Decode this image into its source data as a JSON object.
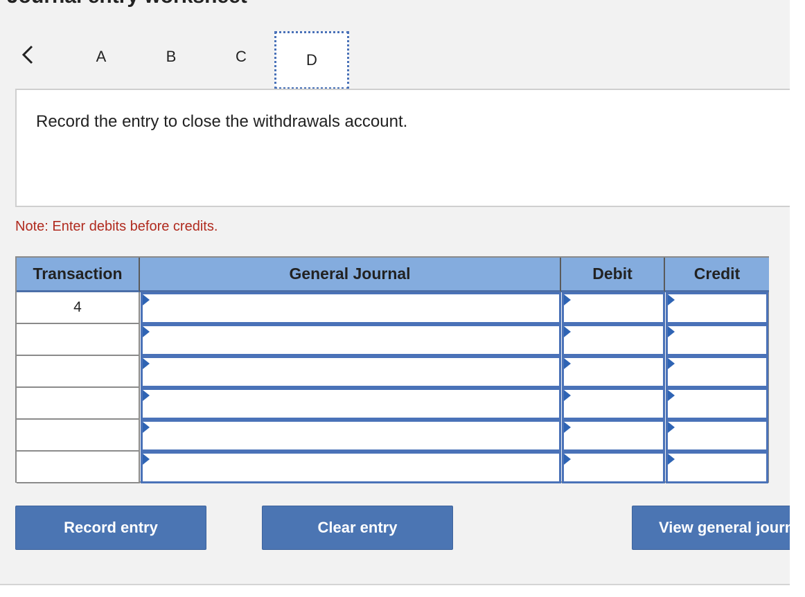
{
  "header": {
    "title": "Journal entry worksheet"
  },
  "tabs": [
    {
      "label": "A"
    },
    {
      "label": "B"
    },
    {
      "label": "C"
    },
    {
      "label": "D"
    }
  ],
  "icons": {
    "back": "chevron-left-icon",
    "input_marker": "triangle-marker-icon"
  },
  "instruction": "Record the entry to close the withdrawals account.",
  "note": "Note: Enter debits before credits.",
  "journal": {
    "columns": [
      "Transaction",
      "General Journal",
      "Debit",
      "Credit"
    ],
    "rows": [
      {
        "transaction": "4",
        "account": "",
        "debit": "",
        "credit": ""
      },
      {
        "transaction": "",
        "account": "",
        "debit": "",
        "credit": ""
      },
      {
        "transaction": "",
        "account": "",
        "debit": "",
        "credit": ""
      },
      {
        "transaction": "",
        "account": "",
        "debit": "",
        "credit": ""
      },
      {
        "transaction": "",
        "account": "",
        "debit": "",
        "credit": ""
      },
      {
        "transaction": "",
        "account": "",
        "debit": "",
        "credit": ""
      }
    ]
  },
  "buttons": {
    "record": "Record entry",
    "clear": "Clear entry",
    "view": "View general journal"
  },
  "colors": {
    "accent": "#4b75b3",
    "header_bg": "#84acde",
    "note": "#b02a1e"
  }
}
